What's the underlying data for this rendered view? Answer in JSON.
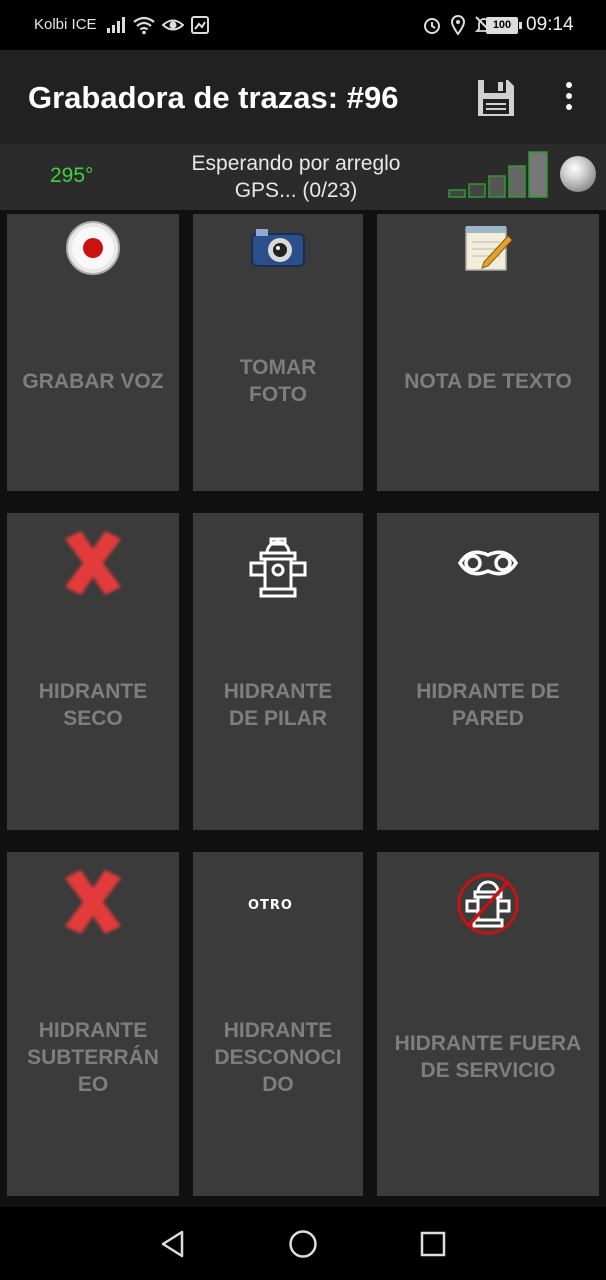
{
  "status_bar": {
    "carrier": "Kolbi ICE",
    "battery": "100",
    "time": "09:14",
    "icons": [
      "signal-bars-icon",
      "wifi-icon",
      "eye-icon",
      "screenshot-icon",
      "alarm-icon",
      "location-icon",
      "notifications-off-icon"
    ]
  },
  "app_bar": {
    "title": "Grabadora de trazas: #96",
    "actions": [
      "save-icon",
      "overflow-menu-icon"
    ]
  },
  "gps_bar": {
    "heading": "295°",
    "status_line1": "Esperando por arreglo",
    "status_line2": "GPS... (0/23)",
    "satellites_in_use": 0,
    "satellites_visible": 23,
    "accent_color": "#3fd13f"
  },
  "tiles": [
    {
      "label_lines": [
        "GRABAR VOZ"
      ],
      "icon": "record-icon"
    },
    {
      "label_lines": [
        "TOMAR",
        "FOTO"
      ],
      "icon": "camera-icon"
    },
    {
      "label_lines": [
        "NOTA DE TEXTO"
      ],
      "icon": "notepad-icon"
    },
    {
      "label_lines": [
        "HIDRANTE",
        "SECO"
      ],
      "icon": "red-x-icon"
    },
    {
      "label_lines": [
        "HIDRANTE",
        "DE PILAR"
      ],
      "icon": "fire-hydrant-icon"
    },
    {
      "label_lines": [
        "HIDRANTE DE",
        "PARED"
      ],
      "icon": "wall-hydrant-icon"
    },
    {
      "label_lines": [
        "HIDRANTE",
        "SUBTERRÁN",
        "EO"
      ],
      "icon": "red-x-icon"
    },
    {
      "label_lines": [
        "HIDRANTE",
        "DESCONOCI",
        "DO"
      ],
      "icon": "otro-text-icon",
      "icon_text": "OTRO"
    },
    {
      "label_lines": [
        "HIDRANTE FUERA",
        "DE SERVICIO"
      ],
      "icon": "hydrant-out-of-service-icon"
    }
  ],
  "nav_bar": {
    "buttons": [
      "back-icon",
      "home-icon",
      "recents-icon"
    ]
  }
}
